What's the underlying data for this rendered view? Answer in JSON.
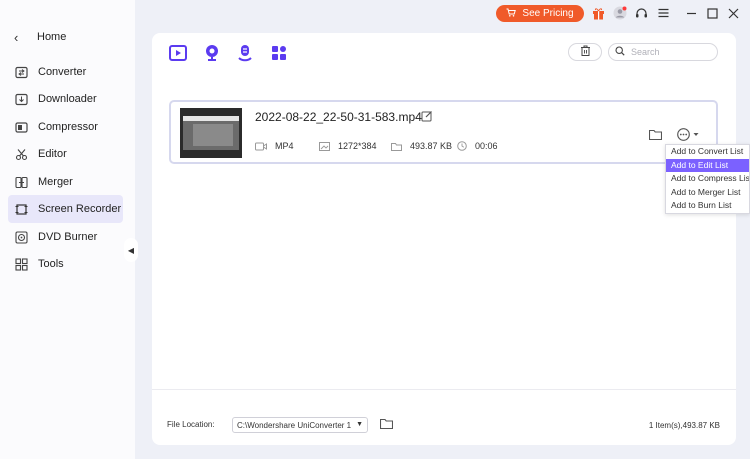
{
  "sidebar": {
    "home_label": "Home",
    "items": [
      {
        "label": "Converter",
        "icon": "converter-icon"
      },
      {
        "label": "Downloader",
        "icon": "downloader-icon"
      },
      {
        "label": "Compressor",
        "icon": "compressor-icon"
      },
      {
        "label": "Editor",
        "icon": "editor-icon"
      },
      {
        "label": "Merger",
        "icon": "merger-icon"
      },
      {
        "label": "Screen Recorder",
        "icon": "screen-recorder-icon"
      },
      {
        "label": "DVD Burner",
        "icon": "dvd-burner-icon"
      },
      {
        "label": "Tools",
        "icon": "tools-icon"
      }
    ],
    "active_item": "Screen Recorder"
  },
  "topbar": {
    "pricing_label": "See Pricing",
    "accent_color": "#f05a2a"
  },
  "toolbar": {
    "search_placeholder": "Search"
  },
  "file": {
    "name": "2022-08-22_22-50-31-583.mp4",
    "format": "MP4",
    "resolution": "1272*384",
    "size": "493.87 KB",
    "duration": "00:06"
  },
  "context_menu": {
    "items": [
      "Add to Convert List",
      "Add to Edit List",
      "Add to Compress List",
      "Add to Merger List",
      "Add to Burn List"
    ],
    "highlighted": "Add to Edit List",
    "highlight_color": "#7b61ff"
  },
  "footer": {
    "location_label": "File Location:",
    "location_value": "C:\\Wondershare UniConverter 1",
    "summary": "1 Item(s),493.87 KB"
  }
}
